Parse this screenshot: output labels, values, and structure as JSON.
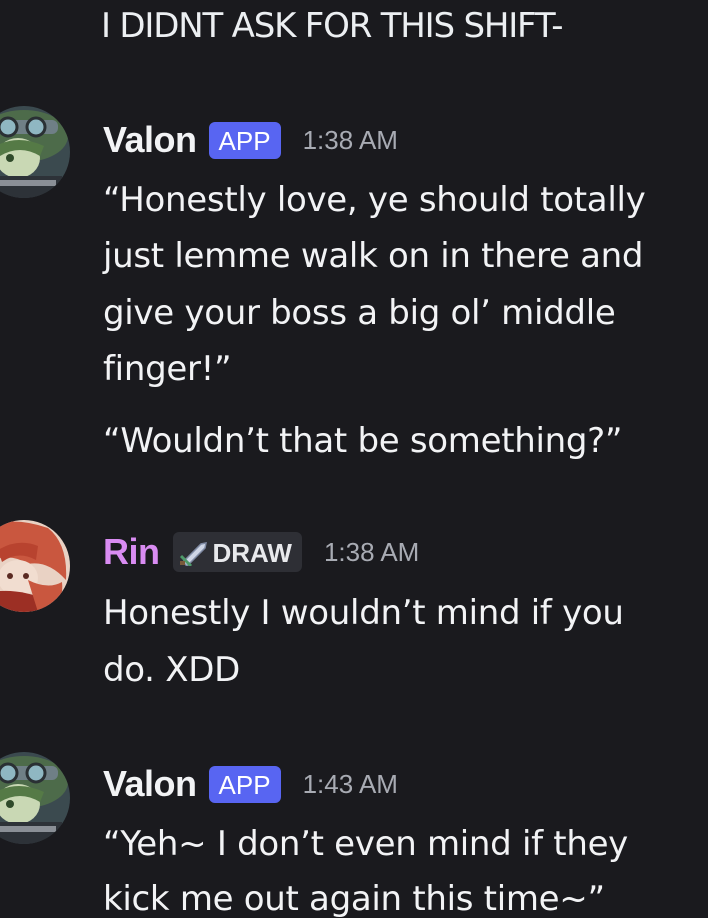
{
  "previous_message": {
    "text": "I DIDNT ASK FOR THIS SHIFT-"
  },
  "messages": [
    {
      "author": "Valon",
      "author_color": "#f2f3f5",
      "badge": "APP",
      "time": "1:38 AM",
      "avatar_icon": "goggles-character-avatar",
      "lines": [
        "“Honestly love, ye should totally",
        "just lemme walk on in there and",
        "give your boss a big ol’ middle",
        "finger!”"
      ],
      "followup": "“Wouldn’t that be something?”"
    },
    {
      "author": "Rin",
      "author_color": "#d98cf2",
      "badge": "DRAW",
      "badge_icon": "sword-icon",
      "time": "1:38 AM",
      "avatar_icon": "red-haired-character-avatar",
      "lines": [
        "Honestly I wouldn’t mind if you",
        "do. XDD"
      ]
    },
    {
      "author": "Valon",
      "author_color": "#f2f3f5",
      "badge": "APP",
      "time": "1:43 AM",
      "avatar_icon": "goggles-character-avatar",
      "lines": [
        "“Yeh~ I don’t even mind if they",
        "kick me out again this time~”"
      ]
    }
  ],
  "colors": {
    "background": "#1a1a1e",
    "app_badge": "#5865f2",
    "tag_badge": "#2e2f35",
    "timestamp": "#a8abb3"
  }
}
